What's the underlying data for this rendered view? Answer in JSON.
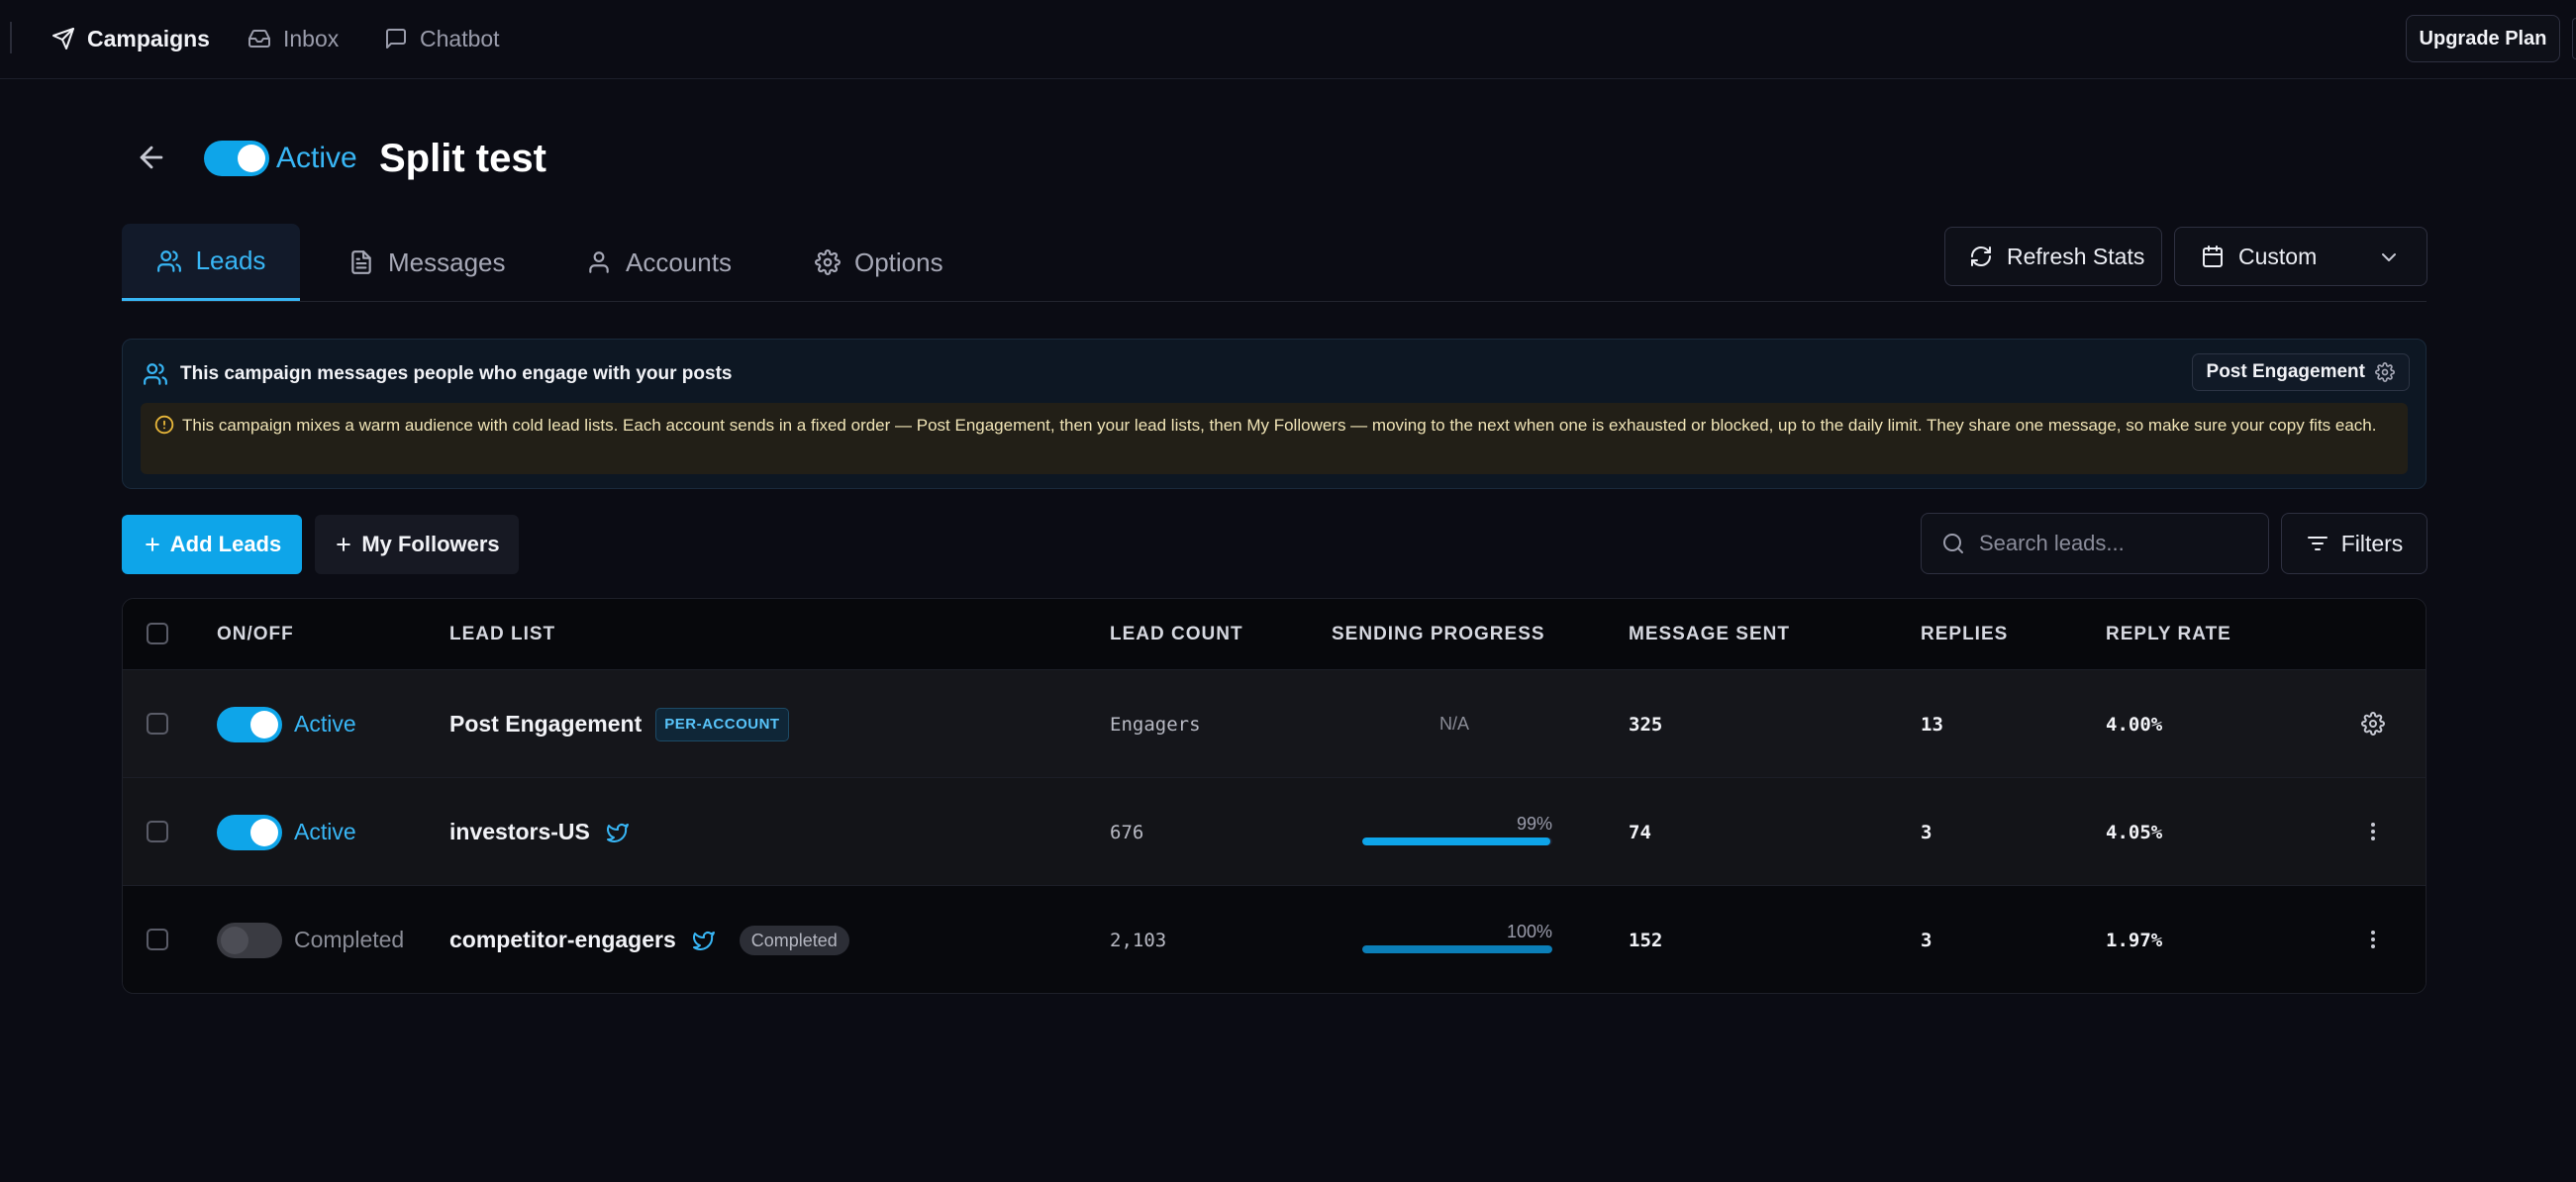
{
  "nav": {
    "campaigns": "Campaigns",
    "inbox": "Inbox",
    "chatbot": "Chatbot",
    "upgrade": "Upgrade Plan"
  },
  "header": {
    "status": "Active",
    "title": "Split test",
    "active": true
  },
  "tabs": {
    "leads": "Leads",
    "messages": "Messages",
    "accounts": "Accounts",
    "options": "Options"
  },
  "toolbar": {
    "refresh": "Refresh Stats",
    "range": "Custom"
  },
  "info": {
    "title": "This campaign messages people who engage with your posts",
    "source_button": "Post Engagement",
    "warning": "This campaign mixes a warm audience with cold lead lists. Each account sends in a fixed order — Post Engagement, then your lead lists, then My Followers — moving to the next when one is exhausted or blocked, up to the daily limit. They share one message, so make sure your copy fits each."
  },
  "actions": {
    "add_leads": "Add Leads",
    "my_followers": "My Followers",
    "search_placeholder": "Search leads...",
    "filters": "Filters"
  },
  "table": {
    "headers": {
      "onoff": "ON/OFF",
      "lead_list": "LEAD LIST",
      "lead_count": "LEAD COUNT",
      "sending_progress": "SENDING PROGRESS",
      "message_sent": "MESSAGE SENT",
      "replies": "REPLIES",
      "reply_rate": "REPLY RATE"
    },
    "rows": [
      {
        "status": "Active",
        "on": true,
        "name": "Post Engagement",
        "badge": "PER-ACCOUNT",
        "lead_count": "Engagers",
        "progress_text": "N/A",
        "sent": "325",
        "replies": "13",
        "reply_rate": "4.00%",
        "action_icon": "gear-icon"
      },
      {
        "status": "Active",
        "on": true,
        "name": "investors-US",
        "source_icon": "twitter-icon",
        "lead_count": "676",
        "progress_text": "99%",
        "progress": 0.99,
        "sent": "74",
        "replies": "3",
        "reply_rate": "4.05%",
        "action_icon": "more-vertical-icon"
      },
      {
        "status": "Completed",
        "on": false,
        "name": "competitor-engagers",
        "source_icon": "twitter-icon",
        "badge": "Completed",
        "lead_count": "2,103",
        "progress_text": "100%",
        "progress": 1.0,
        "sent": "152",
        "replies": "3",
        "reply_rate": "1.97%",
        "action_icon": "more-vertical-icon"
      }
    ]
  },
  "colors": {
    "accent": "#0ea5e9",
    "background": "#0b0c14",
    "warning_bg": "#221f17",
    "warning_text": "#f0e4b6"
  }
}
